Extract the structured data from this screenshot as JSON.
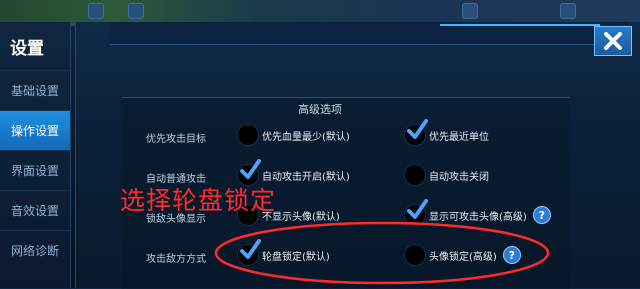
{
  "sidebar": {
    "title": "设置",
    "items": [
      {
        "label": "基础设置",
        "active": false
      },
      {
        "label": "操作设置",
        "active": true
      },
      {
        "label": "界面设置",
        "active": false
      },
      {
        "label": "音效设置",
        "active": false
      },
      {
        "label": "网络诊断",
        "active": false
      }
    ]
  },
  "section": {
    "title": "高级选项"
  },
  "rows": [
    {
      "label": "优先攻击目标",
      "options": [
        {
          "label": "优先血量最少(默认)",
          "checked": false
        },
        {
          "label": "优先最近单位",
          "checked": true
        }
      ]
    },
    {
      "label": "自动普通攻击",
      "options": [
        {
          "label": "自动攻击开启(默认)",
          "checked": true
        },
        {
          "label": "自动攻击关闭",
          "checked": false
        }
      ]
    },
    {
      "label": "锁敌头像显示",
      "options": [
        {
          "label": "不显示头像(默认)",
          "checked": false
        },
        {
          "label": "显示可攻击头像(高级)",
          "checked": true,
          "help": "?"
        }
      ]
    },
    {
      "label": "攻击敌方方式",
      "options": [
        {
          "label": "轮盘锁定(默认)",
          "checked": true
        },
        {
          "label": "头像锁定(高级)",
          "checked": false,
          "help": "?"
        }
      ]
    }
  ],
  "annotation": {
    "text": "选择轮盘锁定",
    "color": "#ff2b2b"
  },
  "colors": {
    "accent": "#1f8fe0",
    "check": "#4aa3ff"
  },
  "icons": {
    "close": "close-icon",
    "check": "check-icon"
  }
}
